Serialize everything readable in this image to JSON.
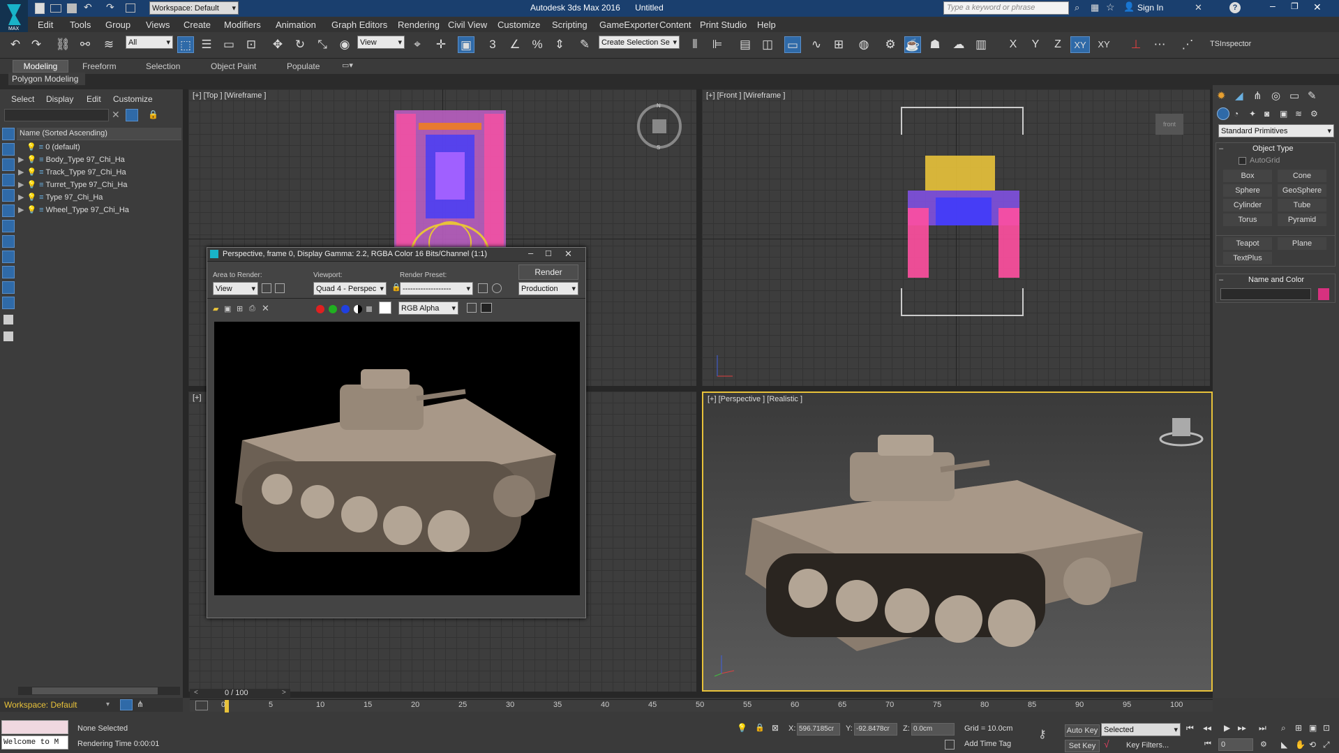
{
  "app": {
    "title": "Autodesk 3ds Max 2016",
    "document": "Untitled",
    "workspace": "Workspace: Default",
    "search_placeholder": "Type a keyword or phrase",
    "sign_in": "Sign In"
  },
  "menu": [
    "Edit",
    "Tools",
    "Group",
    "Views",
    "Create",
    "Modifiers",
    "Animation",
    "Graph Editors",
    "Rendering",
    "Civil View",
    "Customize",
    "Scripting",
    "GameExporter",
    "Content",
    "Print Studio",
    "Help"
  ],
  "toolbar": {
    "selection_filter": "All",
    "ref_coord": "View",
    "named_selection": "Create Selection Se",
    "axes": [
      "X",
      "Y",
      "Z",
      "XY",
      "XY"
    ],
    "tsinspector": "TSInspector"
  },
  "ribbon": {
    "tabs": [
      "Modeling",
      "Freeform",
      "Selection",
      "Object Paint",
      "Populate"
    ],
    "active_tab": "Modeling",
    "subpanel": "Polygon Modeling"
  },
  "scene_explorer": {
    "menus": [
      "Select",
      "Display",
      "Edit",
      "Customize"
    ],
    "column_header": "Name (Sorted Ascending)",
    "items": [
      {
        "name": "0 (default)"
      },
      {
        "name": "Body_Type 97_Chi_Ha"
      },
      {
        "name": "Track_Type 97_Chi_Ha"
      },
      {
        "name": "Turret_Type 97_Chi_Ha"
      },
      {
        "name": "Type 97_Chi_Ha"
      },
      {
        "name": "Wheel_Type 97_Chi_Ha"
      }
    ],
    "workspace_label": "Workspace: Default"
  },
  "viewports": {
    "top": "[+] [Top ] [Wireframe ]",
    "front": "[+] [Front ] [Wireframe ]",
    "left": "[+]",
    "perspective": "[+] [Perspective ] [Realistic ]",
    "viewcube_front": "front"
  },
  "render_window": {
    "title": "Perspective, frame 0, Display Gamma: 2.2, RGBA Color 16 Bits/Channel (1:1)",
    "area_label": "Area to Render:",
    "area_value": "View",
    "viewport_label": "Viewport:",
    "viewport_value": "Quad 4 - Perspec",
    "preset_label": "Render Preset:",
    "preset_value": "-------------------",
    "render_button": "Render",
    "mode_value": "Production",
    "channel_value": "RGB Alpha"
  },
  "command_panel": {
    "category": "Standard Primitives",
    "object_type_title": "Object Type",
    "autogrid": "AutoGrid",
    "buttons": [
      "Box",
      "Cone",
      "Sphere",
      "GeoSphere",
      "Cylinder",
      "Tube",
      "Torus",
      "Pyramid",
      "Teapot",
      "Plane",
      "TextPlus"
    ],
    "name_color_title": "Name and Color",
    "object_color": "#d7317f"
  },
  "timeline": {
    "frame_display": "0 / 100",
    "ticks": [
      "0",
      "5",
      "10",
      "15",
      "20",
      "25",
      "30",
      "35",
      "40",
      "45",
      "50",
      "55",
      "60",
      "65",
      "70",
      "75",
      "80",
      "85",
      "90",
      "95",
      "100"
    ]
  },
  "status": {
    "maxscript": "Welcome to M",
    "selection": "None Selected",
    "render_time": "Rendering Time  0:00:01",
    "x_label": "X:",
    "x_value": "596.7185cr",
    "y_label": "Y:",
    "y_value": "-92.8478cr",
    "z_label": "Z:",
    "z_value": "0.0cm",
    "grid": "Grid = 10.0cm",
    "add_time_tag": "Add Time Tag",
    "auto_key": "Auto Key",
    "set_key": "Set Key",
    "key_mode": "Selected",
    "key_filters": "Key Filters...",
    "frame": "0"
  },
  "colors": {
    "title_blue": "#1a3f6e",
    "accent_yellow": "#e8c23a",
    "tank_color": "#a89888",
    "active_button": "#2f6aa8"
  }
}
